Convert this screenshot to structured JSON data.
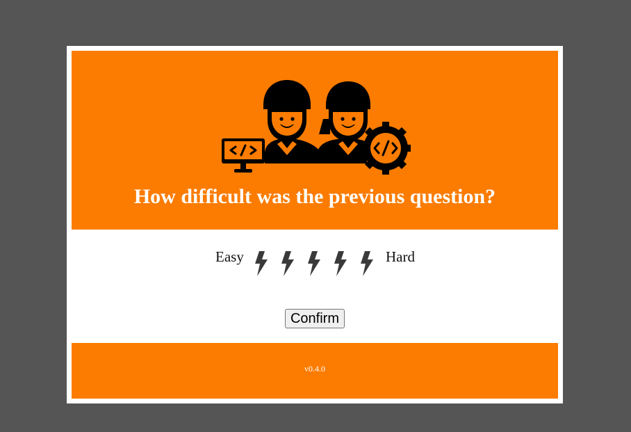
{
  "header": {
    "title": "How difficult was the previous question?",
    "illustration_icon": "developers-team-icon"
  },
  "rating": {
    "min_label": "Easy",
    "max_label": "Hard",
    "scale_max": 5,
    "selected": 0,
    "icon": "lightning-bolt-icon"
  },
  "actions": {
    "confirm_label": "Confirm"
  },
  "footer": {
    "version": "v0.4.0"
  },
  "colors": {
    "background": "#555555",
    "accent": "#fb7c00",
    "panel": "#ffffff",
    "icon": "#3a3a3a"
  }
}
